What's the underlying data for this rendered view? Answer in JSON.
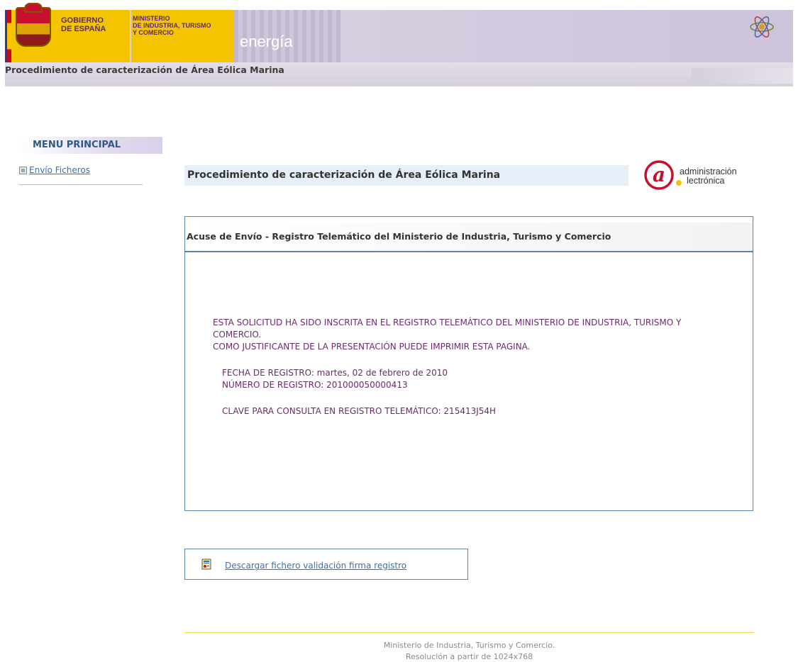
{
  "header": {
    "gobierno_line1": "GOBIERNO",
    "gobierno_line2": "DE ESPAÑA",
    "ministerio_line1": "MINISTERIO",
    "ministerio_line2": "DE INDUSTRIA, TURISMO",
    "ministerio_line3": "Y COMERCIO",
    "section": "energía",
    "page_title": "Procedimiento de caracterización de Área Eólica Marina"
  },
  "menu": {
    "title": "MENU PRINCIPAL",
    "items": [
      {
        "label": "Envío Ficheros"
      }
    ]
  },
  "content": {
    "title": "Procedimiento de caracterización de Área Eólica Marina",
    "logo_line1": "administración",
    "logo_line2": "lectrónica"
  },
  "acuse": {
    "header": "Acuse de Envío - Registro Telemático del Ministerio de Industria, Turismo y Comercio",
    "message_line1": "ESTA SOLICITUD HA SIDO INSCRITA EN EL REGISTRO TELEMÁTICO DEL MINISTERIO DE INDUSTRIA, TURISMO Y",
    "message_line2": "COMERCIO.",
    "message_line3": "COMO JUSTIFICANTE DE LA PRESENTACIÓN PUEDE IMPRIMIR ESTA PAGINA.",
    "fecha": "FECHA DE REGISTRO: martes, 02 de febrero de 2010",
    "numero": "NÚMERO DE REGISTRO: 201000050000413",
    "clave": "CLAVE PARA CONSULTA EN REGISTRO TELEMÁTICO: 215413J54H"
  },
  "download": {
    "label": "Descargar fichero validación firma registro"
  },
  "footer": {
    "line1": "Ministerio de Industria, Turismo y Comercio.",
    "line2": "Resolución a partir de 1024x768"
  }
}
